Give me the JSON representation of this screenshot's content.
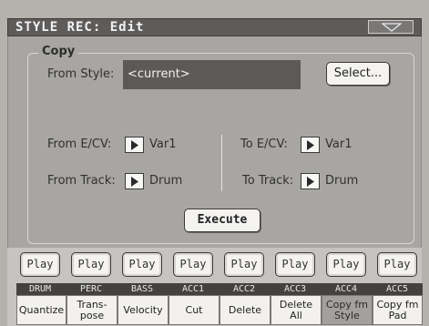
{
  "title": "STYLE REC: Edit",
  "copy_group": {
    "title": "Copy",
    "from_style_label": "From Style:",
    "from_style_value": "<current>",
    "select_button": "Select...",
    "from_ecv_label": "From E/CV:",
    "from_ecv_value": "Var1",
    "to_ecv_label": "To E/CV:",
    "to_ecv_value": "Var1",
    "from_track_label": "From Track:",
    "from_track_value": "Drum",
    "to_track_label": "To Track:",
    "to_track_value": "Drum",
    "execute_button": "Execute"
  },
  "play_label": "Play",
  "tracks": [
    "DRUM",
    "PERC",
    "BASS",
    "ACC1",
    "ACC2",
    "ACC3",
    "ACC4",
    "ACC5"
  ],
  "tabs": [
    {
      "line1": "Quantize",
      "line2": ""
    },
    {
      "line1": "Trans-",
      "line2": "pose"
    },
    {
      "line1": "Velocity",
      "line2": ""
    },
    {
      "line1": "Cut",
      "line2": ""
    },
    {
      "line1": "Delete",
      "line2": ""
    },
    {
      "line1": "Delete",
      "line2": "All"
    },
    {
      "line1": "Copy fm",
      "line2": "Style"
    },
    {
      "line1": "Copy fm",
      "line2": "Pad"
    }
  ],
  "selected_tab": 6
}
